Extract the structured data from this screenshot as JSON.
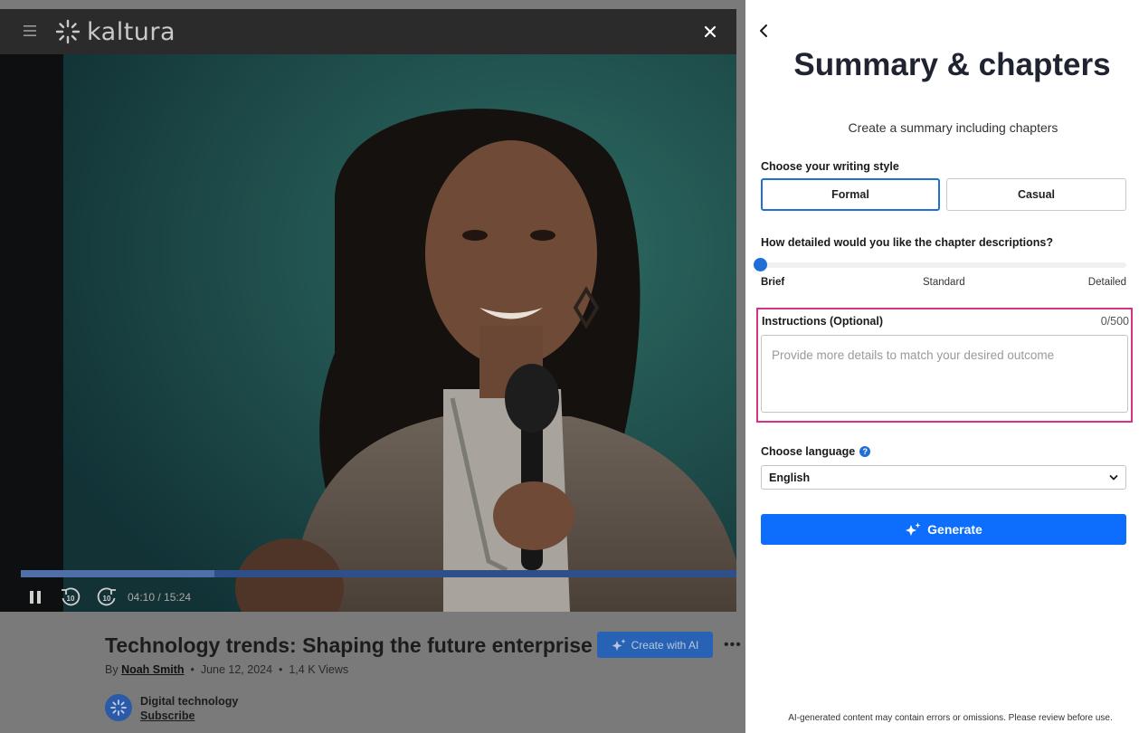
{
  "player": {
    "logo_text": "kaltura",
    "current_time": "04:10",
    "duration": "15:24",
    "time_separator": " / ",
    "progress_fraction": 0.27,
    "rewind_seconds": "10",
    "forward_seconds": "10"
  },
  "video_info": {
    "title": "Technology trends: Shaping the future enterprise",
    "create_ai_label": "Create with AI",
    "by_prefix": "By ",
    "author": "Noah Smith",
    "date": "June 12, 2024",
    "views": "1,4 K Views",
    "channel_name": "Digital technology",
    "subscribe_label": "Subscribe"
  },
  "panel": {
    "title": "Summary & chapters",
    "subtitle": "Create a summary including chapters",
    "writing_style_label": "Choose your writing style",
    "style_options": [
      "Formal",
      "Casual"
    ],
    "selected_style": "Formal",
    "detail_label": "How detailed would you like the chapter descriptions?",
    "detail_levels": [
      "Brief",
      "Standard",
      "Detailed"
    ],
    "selected_detail": "Brief",
    "instructions_label": "Instructions (Optional)",
    "instructions_count": "0/500",
    "instructions_placeholder": "Provide more details to match your desired outcome",
    "instructions_value": "",
    "language_label": "Choose language",
    "language_value": "English",
    "generate_label": "Generate",
    "disclaimer": "AI-generated content may contain errors or omissions. Please review before use."
  },
  "colors": {
    "accent": "#0d6efd",
    "highlight_border": "#d63384",
    "overlay_bg": "#7a7a7a"
  }
}
